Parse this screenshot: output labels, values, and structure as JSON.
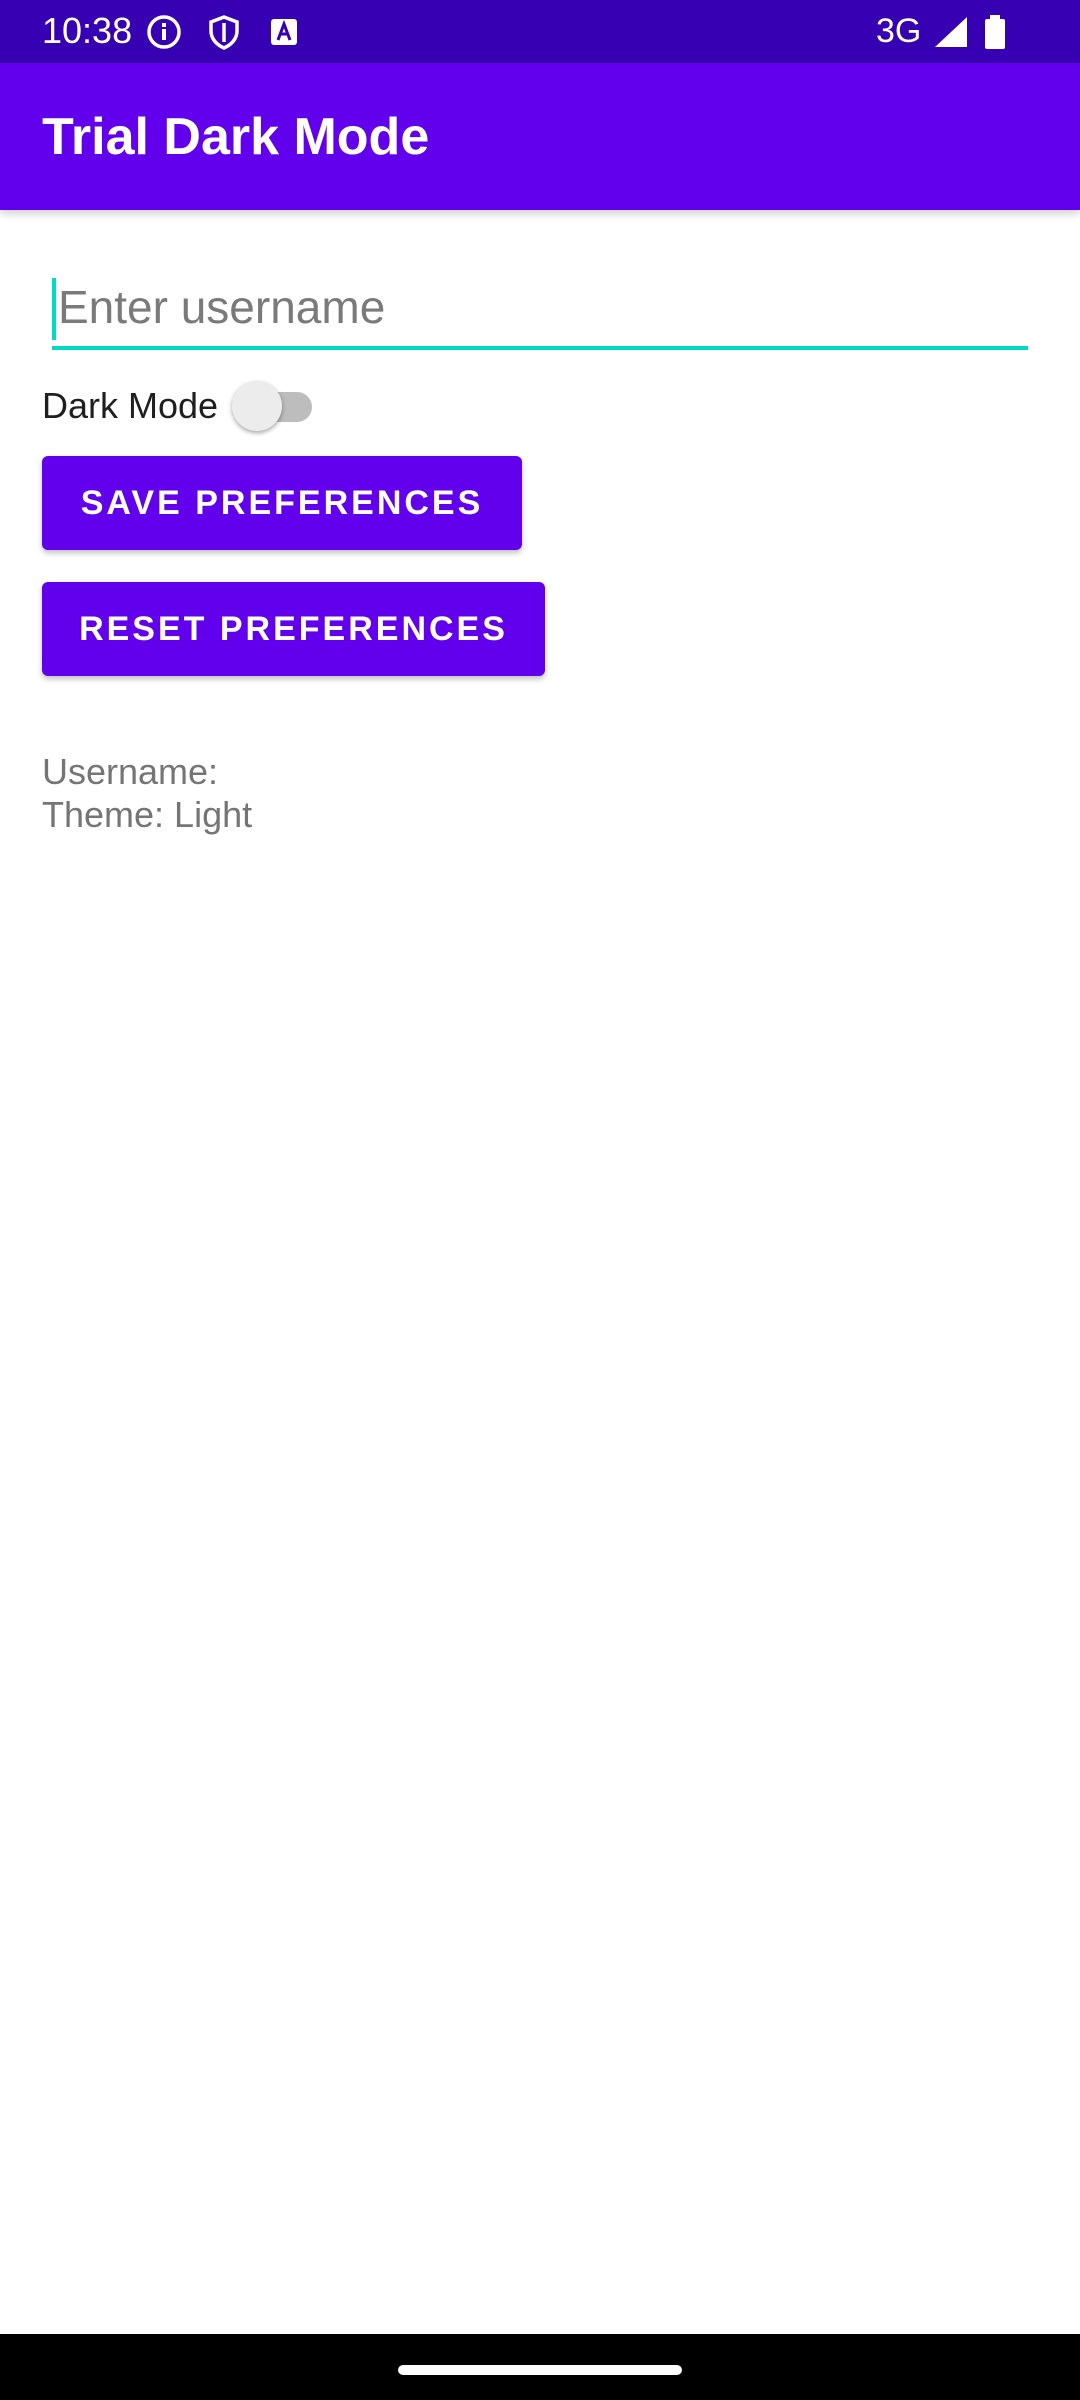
{
  "status_bar": {
    "time": "10:38",
    "network": "3G",
    "background_color": "#3700B3",
    "icons": [
      "info-icon",
      "shield-icon",
      "a11y-badge-icon",
      "signal-icon",
      "battery-icon"
    ]
  },
  "app_bar": {
    "title": "Trial Dark Mode",
    "background_color": "#6200EE"
  },
  "form": {
    "username_value": "",
    "username_placeholder": "Enter username",
    "dark_mode_label": "Dark Mode",
    "dark_mode_on": false,
    "save_label": "Save Preferences",
    "reset_label": "Reset Preferences",
    "accent_color": "#03DAC5"
  },
  "output": {
    "username_text": "Username:",
    "theme_text": "Theme: Light"
  }
}
